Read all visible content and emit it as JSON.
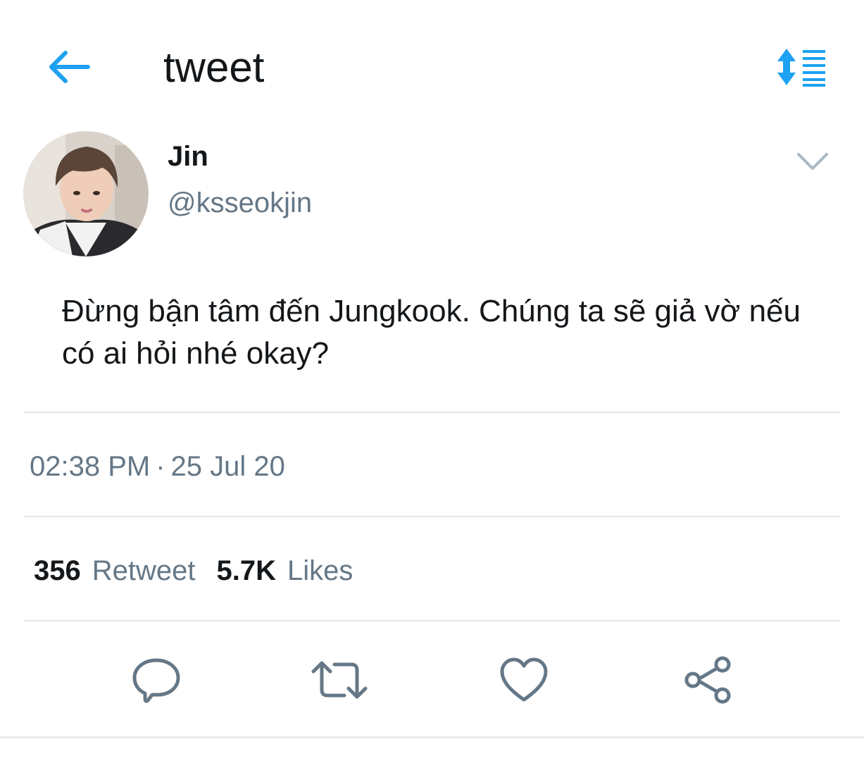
{
  "header": {
    "title": "tweet",
    "back_icon": "arrow-left-icon",
    "sort_icon": "sort-list-icon",
    "accent_color": "#1da1f2"
  },
  "author": {
    "display_name": "Jin",
    "handle": "@ksseokjin",
    "avatar_icon": "profile-photo",
    "menu_icon": "chevron-down-icon"
  },
  "tweet": {
    "text": "Đừng bận tâm đến Jungkook. Chúng ta sẽ giả vờ nếu có ai hỏi nhé okay?",
    "time": "02:38 PM",
    "separator": "·",
    "date": "25 Jul 20"
  },
  "stats": {
    "retweets_count": "356",
    "retweets_label": "Retweet",
    "likes_count": "5.7K",
    "likes_label": "Likes"
  },
  "actions": [
    {
      "icon": "reply-icon"
    },
    {
      "icon": "retweet-icon"
    },
    {
      "icon": "heart-icon"
    },
    {
      "icon": "share-icon"
    }
  ],
  "colors": {
    "primary_text": "#14171a",
    "secondary_text": "#657786",
    "divider": "#e1e8ed",
    "icon_gray": "#657786"
  }
}
